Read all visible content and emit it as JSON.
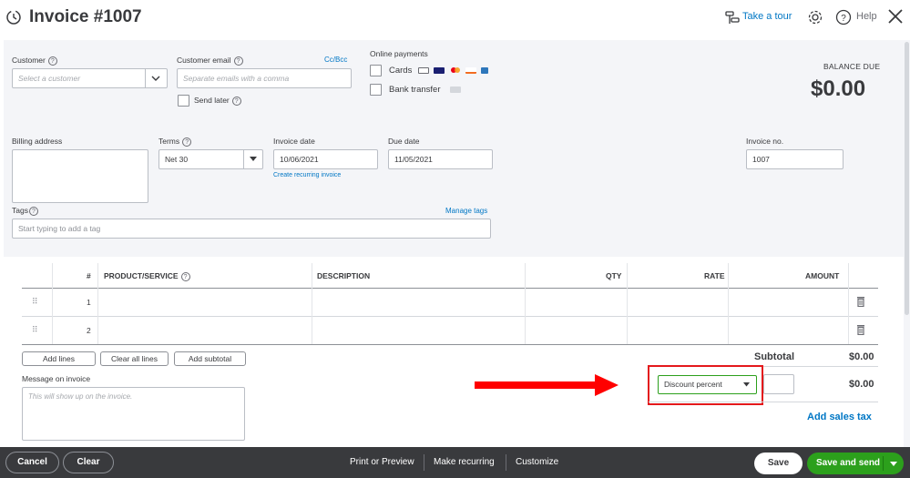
{
  "header": {
    "title": "Invoice #1007",
    "take_tour": "Take a tour",
    "help": "Help"
  },
  "customer": {
    "label": "Customer",
    "placeholder": "Select a customer"
  },
  "customer_email": {
    "label": "Customer email",
    "placeholder": "Separate emails with a comma",
    "cc_bcc": "Cc/Bcc",
    "send_later": "Send later"
  },
  "online_payments": {
    "label": "Online payments",
    "cards": "Cards",
    "bank_transfer": "Bank transfer"
  },
  "balance": {
    "label": "BALANCE DUE",
    "value": "$0.00"
  },
  "billing": {
    "label": "Billing address"
  },
  "terms": {
    "label": "Terms",
    "value": "Net 30"
  },
  "invoice_date": {
    "label": "Invoice date",
    "value": "10/06/2021",
    "recurring_link": "Create recurring invoice"
  },
  "due_date": {
    "label": "Due date",
    "value": "11/05/2021"
  },
  "invoice_no": {
    "label": "Invoice no.",
    "value": "1007"
  },
  "tags": {
    "label": "Tags",
    "manage": "Manage tags",
    "placeholder": "Start typing to add a tag"
  },
  "table": {
    "columns": {
      "num": "#",
      "product": "PRODUCT/SERVICE",
      "description": "DESCRIPTION",
      "qty": "QTY",
      "rate": "RATE",
      "amount": "AMOUNT"
    },
    "rows": [
      {
        "num": "1"
      },
      {
        "num": "2"
      }
    ]
  },
  "actions": {
    "add_lines": "Add lines",
    "clear_all_lines": "Clear all lines",
    "add_subtotal": "Add subtotal"
  },
  "message": {
    "label": "Message on invoice",
    "placeholder": "This will show up on the invoice."
  },
  "totals": {
    "subtotal_label": "Subtotal",
    "subtotal_value": "$0.00",
    "discount_type": "Discount percent",
    "discount_value": "$0.00",
    "add_sales_tax": "Add sales tax"
  },
  "footer": {
    "cancel": "Cancel",
    "clear": "Clear",
    "print_preview": "Print or Preview",
    "make_recurring": "Make recurring",
    "customize": "Customize",
    "save": "Save",
    "save_and_send": "Save and send"
  },
  "colors": {
    "accent_link": "#0077c5",
    "primary_green": "#2ca01c",
    "footer_bg": "#393a3d",
    "highlight_red": "#ff0000"
  }
}
